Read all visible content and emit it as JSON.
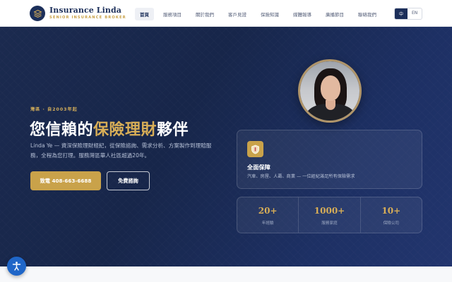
{
  "brand": {
    "name": "Insurance Linda",
    "tagline": "SENIOR INSURANCE BROKER",
    "logo_icon": "layers-icon"
  },
  "nav": {
    "items": [
      {
        "label": "首頁",
        "active": true
      },
      {
        "label": "服務項目",
        "active": false
      },
      {
        "label": "關於我們",
        "active": false
      },
      {
        "label": "客戶見證",
        "active": false
      },
      {
        "label": "保險知識",
        "active": false
      },
      {
        "label": "媒體報導",
        "active": false
      },
      {
        "label": "廣播節目",
        "active": false
      },
      {
        "label": "聯絡我們",
        "active": false
      }
    ]
  },
  "language": {
    "options": [
      "中",
      "EN"
    ],
    "selected": "中"
  },
  "hero": {
    "eyebrow": "灣區 · 自2003年起",
    "title_prefix": "您信賴的",
    "title_highlight": "保險理財",
    "title_suffix": "夥伴",
    "description": "Linda Ye — 資深保險理財經紀，從保險諮詢、需求分析、方案製作到理賠服務，全程為您打理。服務灣區華人社區超過20年。",
    "call_button": "致電 408-663-6688",
    "consult_button": "免費諮詢"
  },
  "coverage_card": {
    "icon": "shield-icon",
    "title": "全面保障",
    "description": "汽車、房屋、人壽、商業 — 一位經紀滿足所有保險需求"
  },
  "stats": [
    {
      "value": "20+",
      "label": "年經驗"
    },
    {
      "value": "1000+",
      "label": "服務家庭"
    },
    {
      "value": "10+",
      "label": "保險公司"
    }
  ],
  "colors": {
    "navy": "#1c2f5a",
    "gold": "#c9a24a",
    "accessibility_blue": "#1f66c8"
  },
  "accessibility": {
    "icon": "accessibility-icon"
  }
}
